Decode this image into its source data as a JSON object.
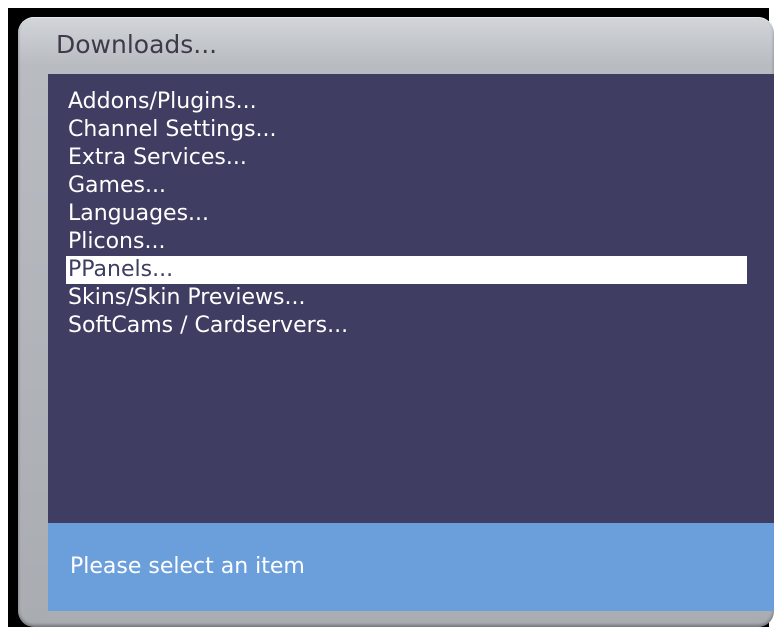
{
  "window": {
    "title": "Downloads..."
  },
  "menu": {
    "items": [
      {
        "label": "Addons/Plugins..."
      },
      {
        "label": "Channel Settings..."
      },
      {
        "label": "Extra Services..."
      },
      {
        "label": "Games..."
      },
      {
        "label": "Languages..."
      },
      {
        "label": "Plicons..."
      },
      {
        "label": "PPanels...",
        "selected": true
      },
      {
        "label": "Skins/Skin Previews..."
      },
      {
        "label": "SoftCams / Cardservers..."
      }
    ]
  },
  "status": {
    "text": "Please select an item"
  },
  "colors": {
    "panel_background": "#3f3d61",
    "status_background": "#6a9fdb",
    "selection_background": "#ffffff",
    "frame": "#b8bcc1"
  }
}
